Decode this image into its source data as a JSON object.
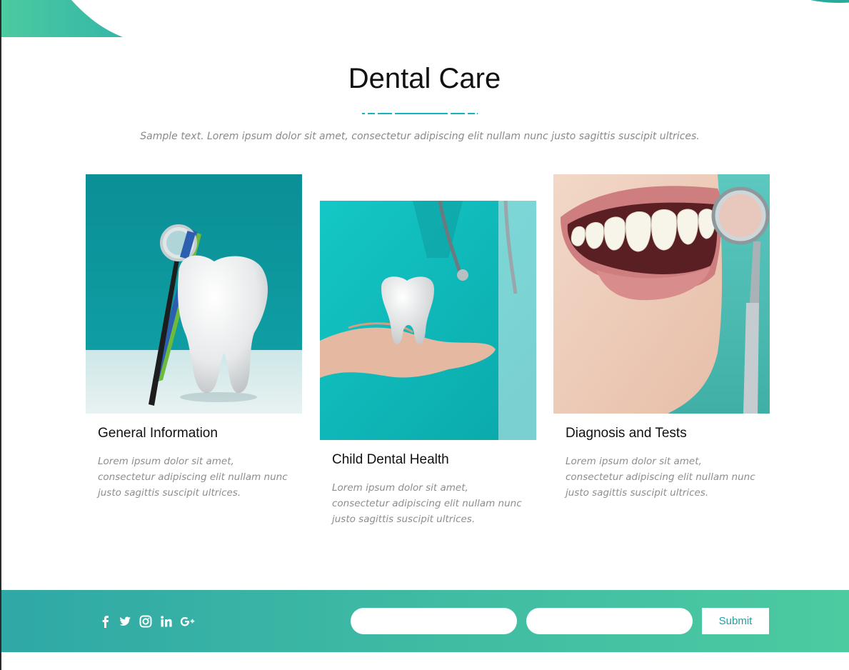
{
  "section": {
    "title": "Dental Care",
    "subtitle": "Sample text. Lorem ipsum dolor sit amet, consectetur adipiscing elit nullam nunc justo sagittis suscipit ultrices."
  },
  "cards": [
    {
      "title": "General Information",
      "text": "Lorem ipsum dolor sit amet, consectetur adipiscing elit nullam nunc justo sagittis suscipit ultrices."
    },
    {
      "title": "Child Dental Health",
      "text": "Lorem ipsum dolor sit amet, consectetur adipiscing elit nullam nunc justo sagittis suscipit ultrices."
    },
    {
      "title": "Diagnosis and Tests",
      "text": "Lorem ipsum dolor sit amet, consectetur adipiscing elit nullam nunc justo sagittis suscipit ultrices."
    }
  ],
  "footer": {
    "social_icons": [
      "facebook-icon",
      "twitter-icon",
      "instagram-icon",
      "linkedin-icon",
      "google-plus-icon"
    ],
    "name_field_placeholder": "",
    "email_field_placeholder": "",
    "submit_label": "Submit"
  },
  "colors": {
    "accent": "#17b3be",
    "footer_start": "#2fa8a6",
    "footer_end": "#4ccaa0",
    "submit_text": "#2a9aa2"
  }
}
